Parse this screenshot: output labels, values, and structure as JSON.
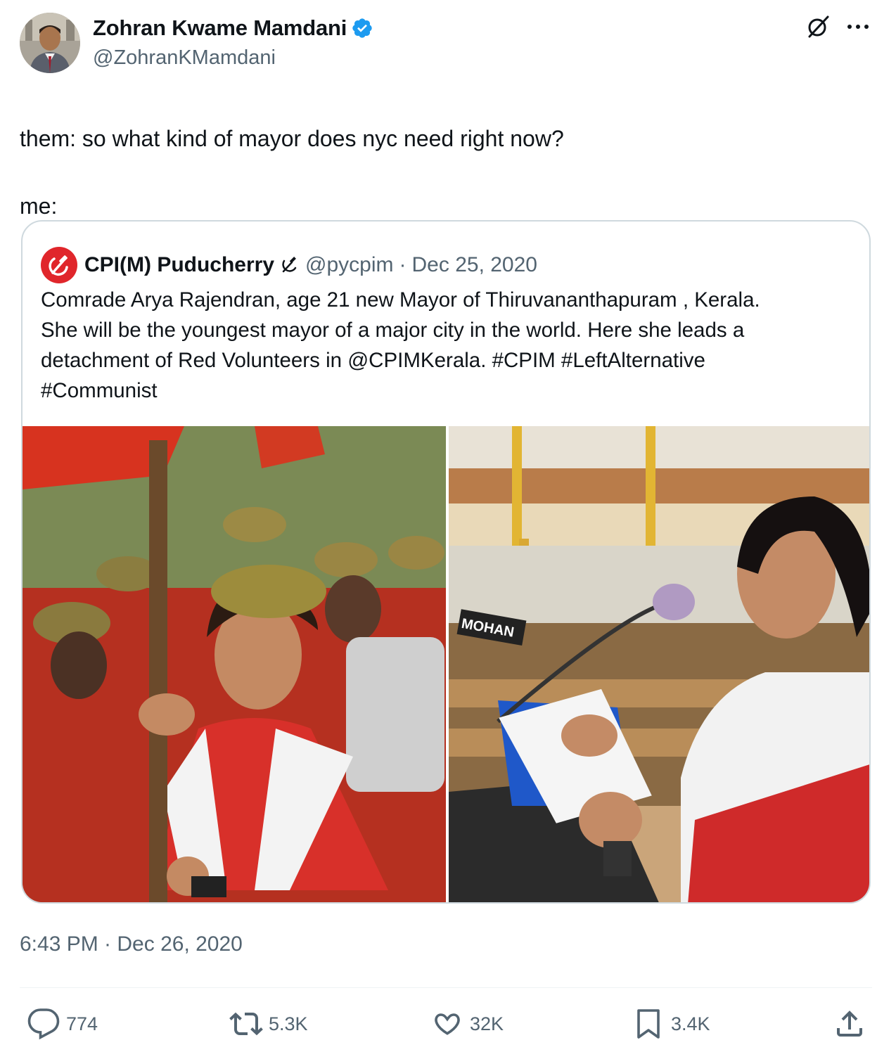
{
  "author": {
    "display_name": "Zohran Kwame Mamdani",
    "handle": "@ZohranKMamdani",
    "verified": true
  },
  "tweet": {
    "line1": "them: so what kind of mayor does nyc need right now?",
    "line2": "me:",
    "timestamp": "6:43 PM · Dec 26, 2020"
  },
  "quoted": {
    "display_name": "CPI(M) Puducherry",
    "emoji": "hammer-sickle",
    "handle": "@pycpim",
    "separator": "·",
    "date": "Dec 25, 2020",
    "text_lines": [
      "Comrade Arya Rajendran, age 21  new Mayor of Thiruvananthapuram , Kerala.",
      "She will be the youngest mayor of a major city in the world. Here she leads a",
      "detachment of Red Volunteers in @CPIMKerala. #CPIM  #LeftAlternative",
      "#Communist"
    ],
    "photo_right_sign": "MOHAN"
  },
  "actions": {
    "replies": "774",
    "reposts": "5.3K",
    "likes": "32K",
    "bookmarks": "3.4K"
  },
  "colors": {
    "text": "#0f1419",
    "secondary": "#536471",
    "verified": "#1d9bf0",
    "border": "#cfd9de",
    "party_red": "#e0262b"
  }
}
